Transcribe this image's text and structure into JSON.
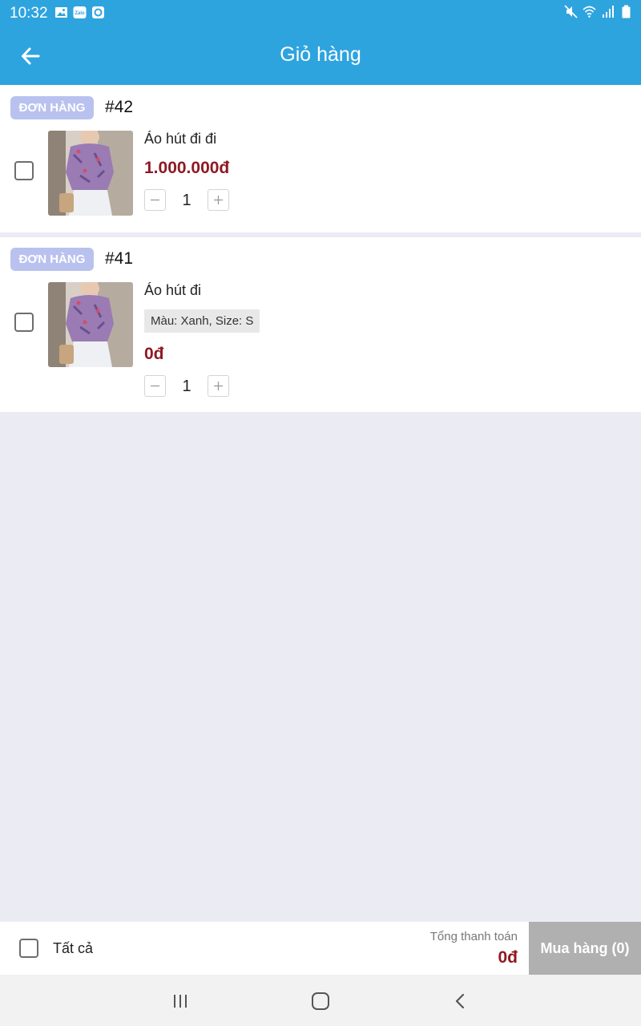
{
  "status_bar": {
    "time": "10:32",
    "left_icons": [
      "gallery-icon",
      "zalo-icon",
      "app-notification-icon"
    ],
    "right_icons": [
      "mute-icon",
      "wifi-icon",
      "signal-icon",
      "battery-icon"
    ]
  },
  "header": {
    "title": "Giỏ hàng",
    "back_icon": "arrow-left-icon",
    "background": "#2ea4df"
  },
  "orders": [
    {
      "badge": "ĐƠN HÀNG",
      "id": "#42",
      "item": {
        "name": "Áo hút đi đi",
        "variant": "",
        "price": "1.000.000đ",
        "quantity": "1",
        "checked": false
      }
    },
    {
      "badge": "ĐƠN HÀNG",
      "id": "#41",
      "item": {
        "name": "Áo hút đi",
        "variant": "Màu: Xanh, Size: S",
        "price": "0đ",
        "quantity": "1",
        "checked": false
      }
    }
  ],
  "footer": {
    "select_all_label": "Tất cả",
    "total_label": "Tổng thanh toán",
    "total_value": "0đ",
    "buy_button_label": "Mua hàng (0)"
  },
  "nav_bar": {
    "buttons": [
      "recent-apps-icon",
      "home-icon",
      "back-nav-icon"
    ]
  },
  "colors": {
    "accent": "#2ea4df",
    "price": "#8e1a22",
    "badge": "#b9c2ef",
    "buy_button": "#b0b0b0",
    "page_background": "#ebebf4"
  }
}
